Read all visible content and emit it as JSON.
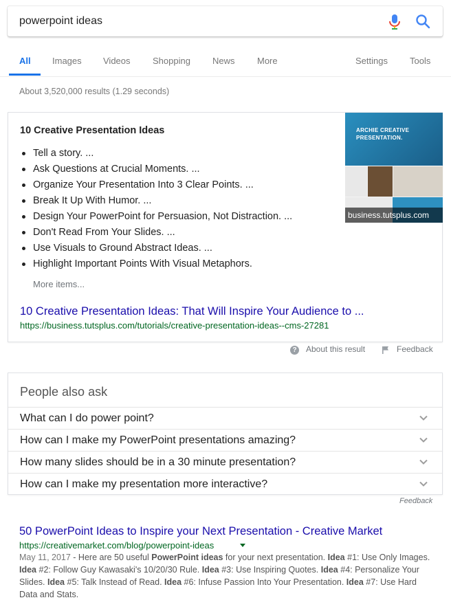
{
  "search": {
    "query": "powerpoint ideas"
  },
  "tabs": [
    "All",
    "Images",
    "Videos",
    "Shopping",
    "News",
    "More",
    "Settings",
    "Tools"
  ],
  "stats": "About 3,520,000 results (1.29 seconds)",
  "featured": {
    "title": "10 Creative Presentation Ideas",
    "items": [
      "Tell a story. ...",
      "Ask Questions at Crucial Moments. ...",
      "Organize Your Presentation Into 3 Clear Points. ...",
      "Break It Up With Humor. ...",
      "Design Your PowerPoint for Persuasion, Not Distraction. ...",
      "Don't Read From Your Slides. ...",
      "Use Visuals to Ground Abstract Ideas. ...",
      "Highlight Important Points With Visual Metaphors."
    ],
    "more_items": "More items...",
    "link_title": "10 Creative Presentation Ideas: That Will Inspire Your Audience to ...",
    "link_url": "https://business.tutsplus.com/tutorials/creative-presentation-ideas--cms-27281",
    "thumb_caption": "business.tutsplus.com",
    "thumb_text": "ARCHIE CREATIVE PRESENTATION."
  },
  "about_result": "About this result",
  "feedback": "Feedback",
  "paa": {
    "title": "People also ask",
    "questions": [
      "What can I do power point?",
      "How can I make my PowerPoint presentations amazing?",
      "How many slides should be in a 30 minute presentation?",
      "How can I make my presentation more interactive?"
    ],
    "feedback": "Feedback"
  },
  "result": {
    "title": "50 PowerPoint Ideas to Inspire your Next Presentation - Creative Market",
    "url": "https://creativemarket.com/blog/powerpoint-ideas",
    "date": "May 11, 2017",
    "snippet_parts": [
      " - Here are 50 useful ",
      "PowerPoint ideas",
      " for your next presentation. ",
      "Idea",
      " #1: Use Only Images. ",
      "Idea",
      " #2: Follow Guy Kawasaki's 10/20/30 Rule. ",
      "Idea",
      " #3: Use Inspiring Quotes. ",
      "Idea",
      " #4: Personalize Your Slides. ",
      "Idea",
      " #5: Talk Instead of Read. ",
      "Idea",
      " #6: Infuse Passion Into Your Presentation. ",
      "Idea",
      " #7: Use Hard Data and Stats."
    ]
  },
  "colors": {
    "link": "#1a0dab",
    "url": "#006621",
    "accent": "#1a73e8"
  }
}
